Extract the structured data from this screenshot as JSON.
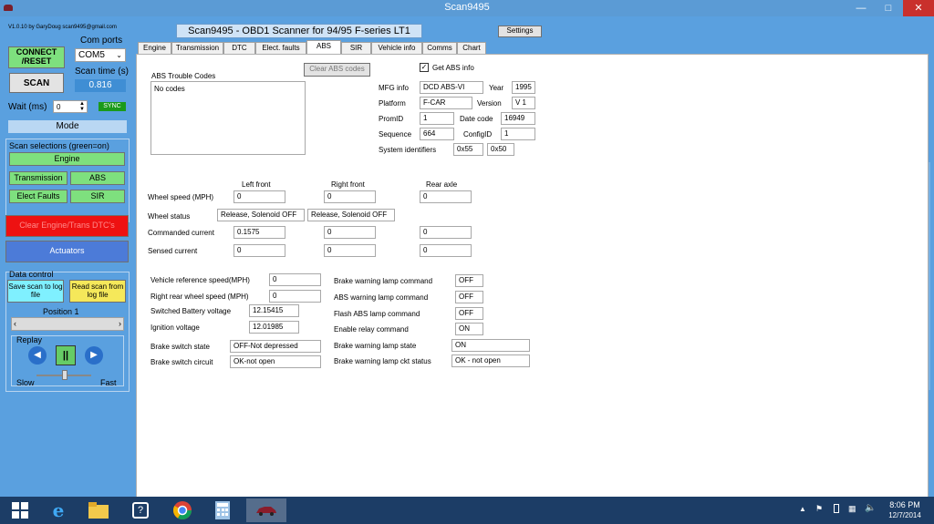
{
  "window": {
    "title": "Scan9495",
    "min": "—",
    "max": "□",
    "close": "✕"
  },
  "left": {
    "version": "V1.0.10  by GaryDoug scan9495@gmail.com",
    "connect": "CONNECT\n/RESET",
    "com_ports_label": "Com ports",
    "com_port_value": "COM5",
    "scan_time_label": "Scan time (s)",
    "scan_time_value": "0.816",
    "scan": "SCAN",
    "wait_label": "Wait (ms)",
    "wait_value": "0",
    "sync": "SYNC",
    "mode": "Mode",
    "scan_selections": "Scan selections (green=on)",
    "sel_engine": "Engine",
    "sel_transmission": "Transmission",
    "sel_abs": "ABS",
    "sel_elect_faults": "Elect Faults",
    "sel_sir": "SIR",
    "clear_dtcs": "Clear Engine/Trans DTC's",
    "actuators": "Actuators",
    "data_control": "Data control",
    "save_scan": "Save scan to log file",
    "read_scan": "Read scan from log file",
    "position": "Position  1",
    "replay": "Replay",
    "slow": "Slow",
    "fast": "Fast"
  },
  "header": {
    "app_title": "Scan9495 - OBD1 Scanner for 94/95 F-series LT1",
    "settings": "Settings"
  },
  "tabs": [
    "Engine",
    "Transmission",
    "DTC",
    "Elect. faults",
    "ABS",
    "SIR",
    "Vehicle info",
    "Comms",
    "Chart"
  ],
  "active_tab": "ABS",
  "abs": {
    "trouble_codes_label": "ABS Trouble Codes",
    "trouble_codes_value": "No codes",
    "clear_button": "Clear ABS codes",
    "get_abs_info": "Get ABS info",
    "mfg_info_label": "MFG info",
    "mfg_info": "DCD ABS-VI",
    "year_label": "Year",
    "year": "1995",
    "platform_label": "Platform",
    "platform": "F-CAR",
    "version_label": "Version",
    "version": "V 1",
    "promid_label": "PromID",
    "promid": "1",
    "date_code_label": "Date code",
    "date_code": "16949",
    "sequence_label": "Sequence",
    "sequence": "664",
    "configid_label": "ConfigID",
    "configid": "1",
    "sys_id_label": "System identifiers",
    "sys_id_1": "0x55",
    "sys_id_2": "0x50",
    "col_left_front": "Left front",
    "col_right_front": "Right front",
    "col_rear_axle": "Rear axle",
    "wheel_speed_label": "Wheel speed (MPH)",
    "wheel_speed": [
      "0",
      "0",
      "0"
    ],
    "wheel_status_label": "Wheel status",
    "wheel_status": [
      "Release, Solenoid OFF",
      "Release, Solenoid OFF"
    ],
    "commanded_current_label": "Commanded current",
    "commanded_current": [
      "0.1575",
      "0",
      "0"
    ],
    "sensed_current_label": "Sensed current",
    "sensed_current": [
      "0",
      "0",
      "0"
    ],
    "veh_ref_speed_label": "Vehicle reference speed(MPH)",
    "veh_ref_speed": "0",
    "rr_wheel_speed_label": "Right rear wheel speed (MPH)",
    "rr_wheel_speed": "0",
    "batt_voltage_label": "Switched Battery voltage",
    "batt_voltage": "12.15415",
    "ign_voltage_label": "Ignition voltage",
    "ign_voltage": "12.01985",
    "brake_switch_state_label": "Brake switch state",
    "brake_switch_state": "OFF-Not depressed",
    "brake_switch_circuit_label": "Brake switch circuit",
    "brake_switch_circuit": "OK-not open",
    "brake_warn_cmd_label": "Brake warning lamp command",
    "brake_warn_cmd": "OFF",
    "abs_warn_cmd_label": "ABS warning lamp command",
    "abs_warn_cmd": "OFF",
    "flash_abs_cmd_label": "Flash ABS lamp command",
    "flash_abs_cmd": "OFF",
    "relay_cmd_label": "Enable relay command",
    "relay_cmd": "ON",
    "brake_lamp_state_label": "Brake warning lamp state",
    "brake_lamp_state": "ON",
    "brake_lamp_ckt_label": "Brake warning lamp ckt status",
    "brake_lamp_ckt": "OK - not open"
  },
  "taskbar": {
    "time": "8:06 PM",
    "date": "12/7/2014"
  },
  "colors": {
    "titlebar": "#5b9bd5",
    "client": "#5aa0df",
    "green": "#7ee07e",
    "red": "#ee1111",
    "blue": "#4c7bd8",
    "yellow": "#f5e85a",
    "cyan": "#7ff0ff",
    "taskbar": "#1c3d66"
  }
}
